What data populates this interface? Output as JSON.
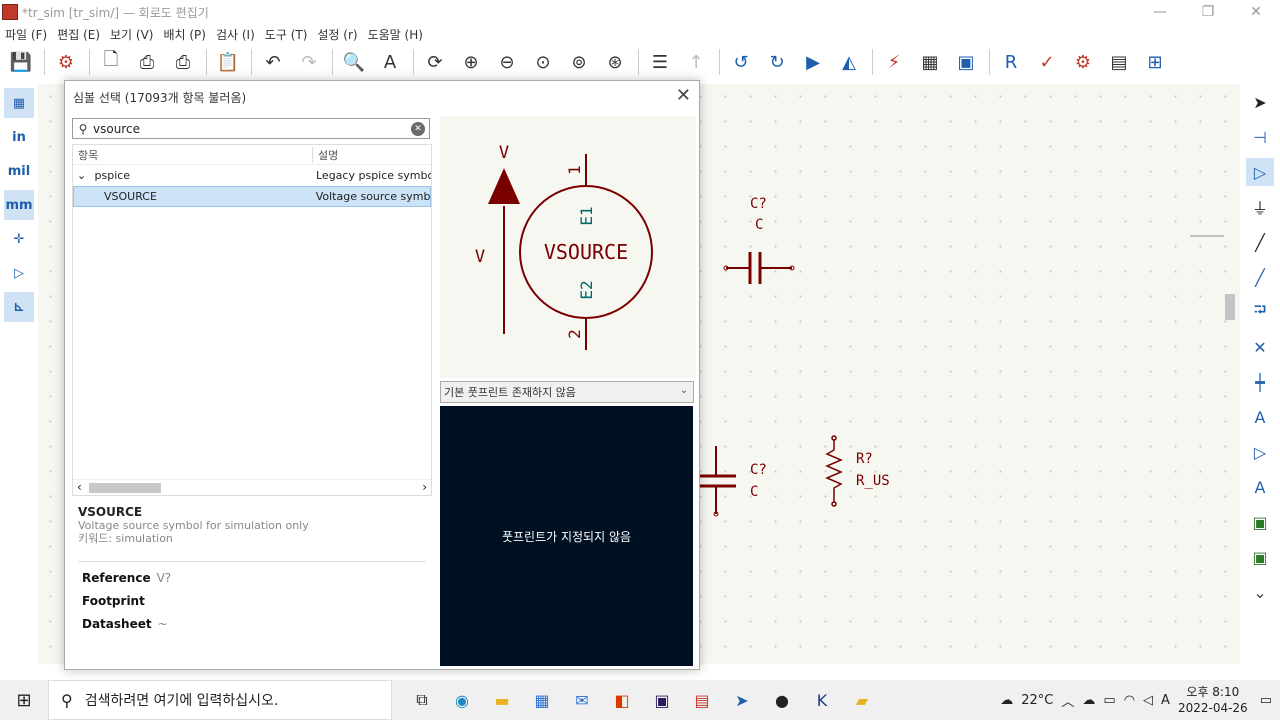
{
  "window": {
    "title": "*tr_sim [tr_sim/] — 회로도 편집기",
    "minimize": "—",
    "restore": "❐",
    "close": "✕"
  },
  "menu": [
    "파일 (F)",
    "편집 (E)",
    "보기 (V)",
    "배치 (P)",
    "검사 (I)",
    "도구 (T)",
    "설정 (r)",
    "도움말 (H)"
  ],
  "toolbar_icons": [
    "save-icon",
    "schematic-setup-icon",
    "new-page-icon",
    "print-icon",
    "plot-icon",
    "paste-icon",
    "undo-icon",
    "redo-icon",
    "find-icon",
    "find-replace-icon",
    "refresh-icon",
    "zoom-in-icon",
    "zoom-out-icon",
    "zoom-fit-icon",
    "zoom-objects-icon",
    "zoom-selection-icon",
    "hierarchy-icon",
    "leave-sheet-icon",
    "rotate-ccw-icon",
    "rotate-cw-icon",
    "mirror-h-icon",
    "mirror-v-icon",
    "symbol-editor-icon",
    "symbol-library-icon",
    "footprint-assign-icon",
    "annotate-icon",
    "erc-icon",
    "netlist-icon",
    "bom-table-icon",
    "bom-icon"
  ],
  "left_toolbar": [
    {
      "name": "grid-toggle",
      "label": "▦"
    },
    {
      "name": "units-inches",
      "label": "in"
    },
    {
      "name": "units-mils",
      "label": "mil"
    },
    {
      "name": "units-mm",
      "label": "mm"
    },
    {
      "name": "cursor-crosshair",
      "label": "✛"
    },
    {
      "name": "hidden-pins",
      "label": "▷"
    },
    {
      "name": "line-mode",
      "label": "⊾"
    }
  ],
  "right_toolbar": [
    "select-icon",
    "highlight-net-icon",
    "add-symbol-icon",
    "add-power-icon",
    "add-wire-icon",
    "add-bus-icon",
    "bus-entry-icon",
    "no-connect-icon",
    "junction-icon",
    "label-icon",
    "global-label-icon",
    "hier-label-icon",
    "add-sheet-icon",
    "import-sheet-pin-icon",
    "scroll-down-icon"
  ],
  "canvas": {
    "components": [
      {
        "ref": "C?",
        "value": "C"
      },
      {
        "ref": "C?",
        "value": "C"
      },
      {
        "ref": "R?",
        "value": "R_US"
      }
    ]
  },
  "dialog": {
    "title": "심볼 선택 (17093개 항목 불러옴)",
    "close": "✕",
    "search": {
      "value": "vsource",
      "placeholder": "",
      "clear": "✕"
    },
    "tree": {
      "col_item": "항목",
      "col_desc": "설명",
      "rows": [
        {
          "item": "pspice",
          "desc": "Legacy pspice symbo",
          "expand": "⌄"
        },
        {
          "item": "VSOURCE",
          "desc": "Voltage source symb"
        }
      ],
      "scroll_left": "‹",
      "scroll_right": "›"
    },
    "details": {
      "name": "VSOURCE",
      "description": "Voltage source symbol for simulation only",
      "keywords": "키워드: simulation",
      "fields": [
        {
          "label": "Reference",
          "value": "V?"
        },
        {
          "label": "Footprint",
          "value": ""
        },
        {
          "label": "Datasheet",
          "value": "~"
        }
      ]
    },
    "symbol_preview": {
      "name": "VSOURCE",
      "pin1": "1",
      "pin2": "2",
      "e1": "E1",
      "e2": "E2",
      "v_top": "V",
      "v_left": "V"
    },
    "footprint_select": "기본 풋프린트 존재하지 않음",
    "footprint_select_arrow": "⌄",
    "footprint_message": "풋프린트가 지정되지 않음"
  },
  "taskbar": {
    "start": "⊞",
    "search_icon": "⚲",
    "search_placeholder": "검색하려면 여기에 입력하십시오.",
    "weather": "22°C",
    "time": "오후 8:10",
    "date": "2022-04-26",
    "input_mode": "A"
  },
  "colors": {
    "accent": "#1f5fae",
    "component": "#7a0000",
    "canvas_bg": "#f7f7f2",
    "footprint_bg": "#001023",
    "selection": "#cde3f7"
  }
}
